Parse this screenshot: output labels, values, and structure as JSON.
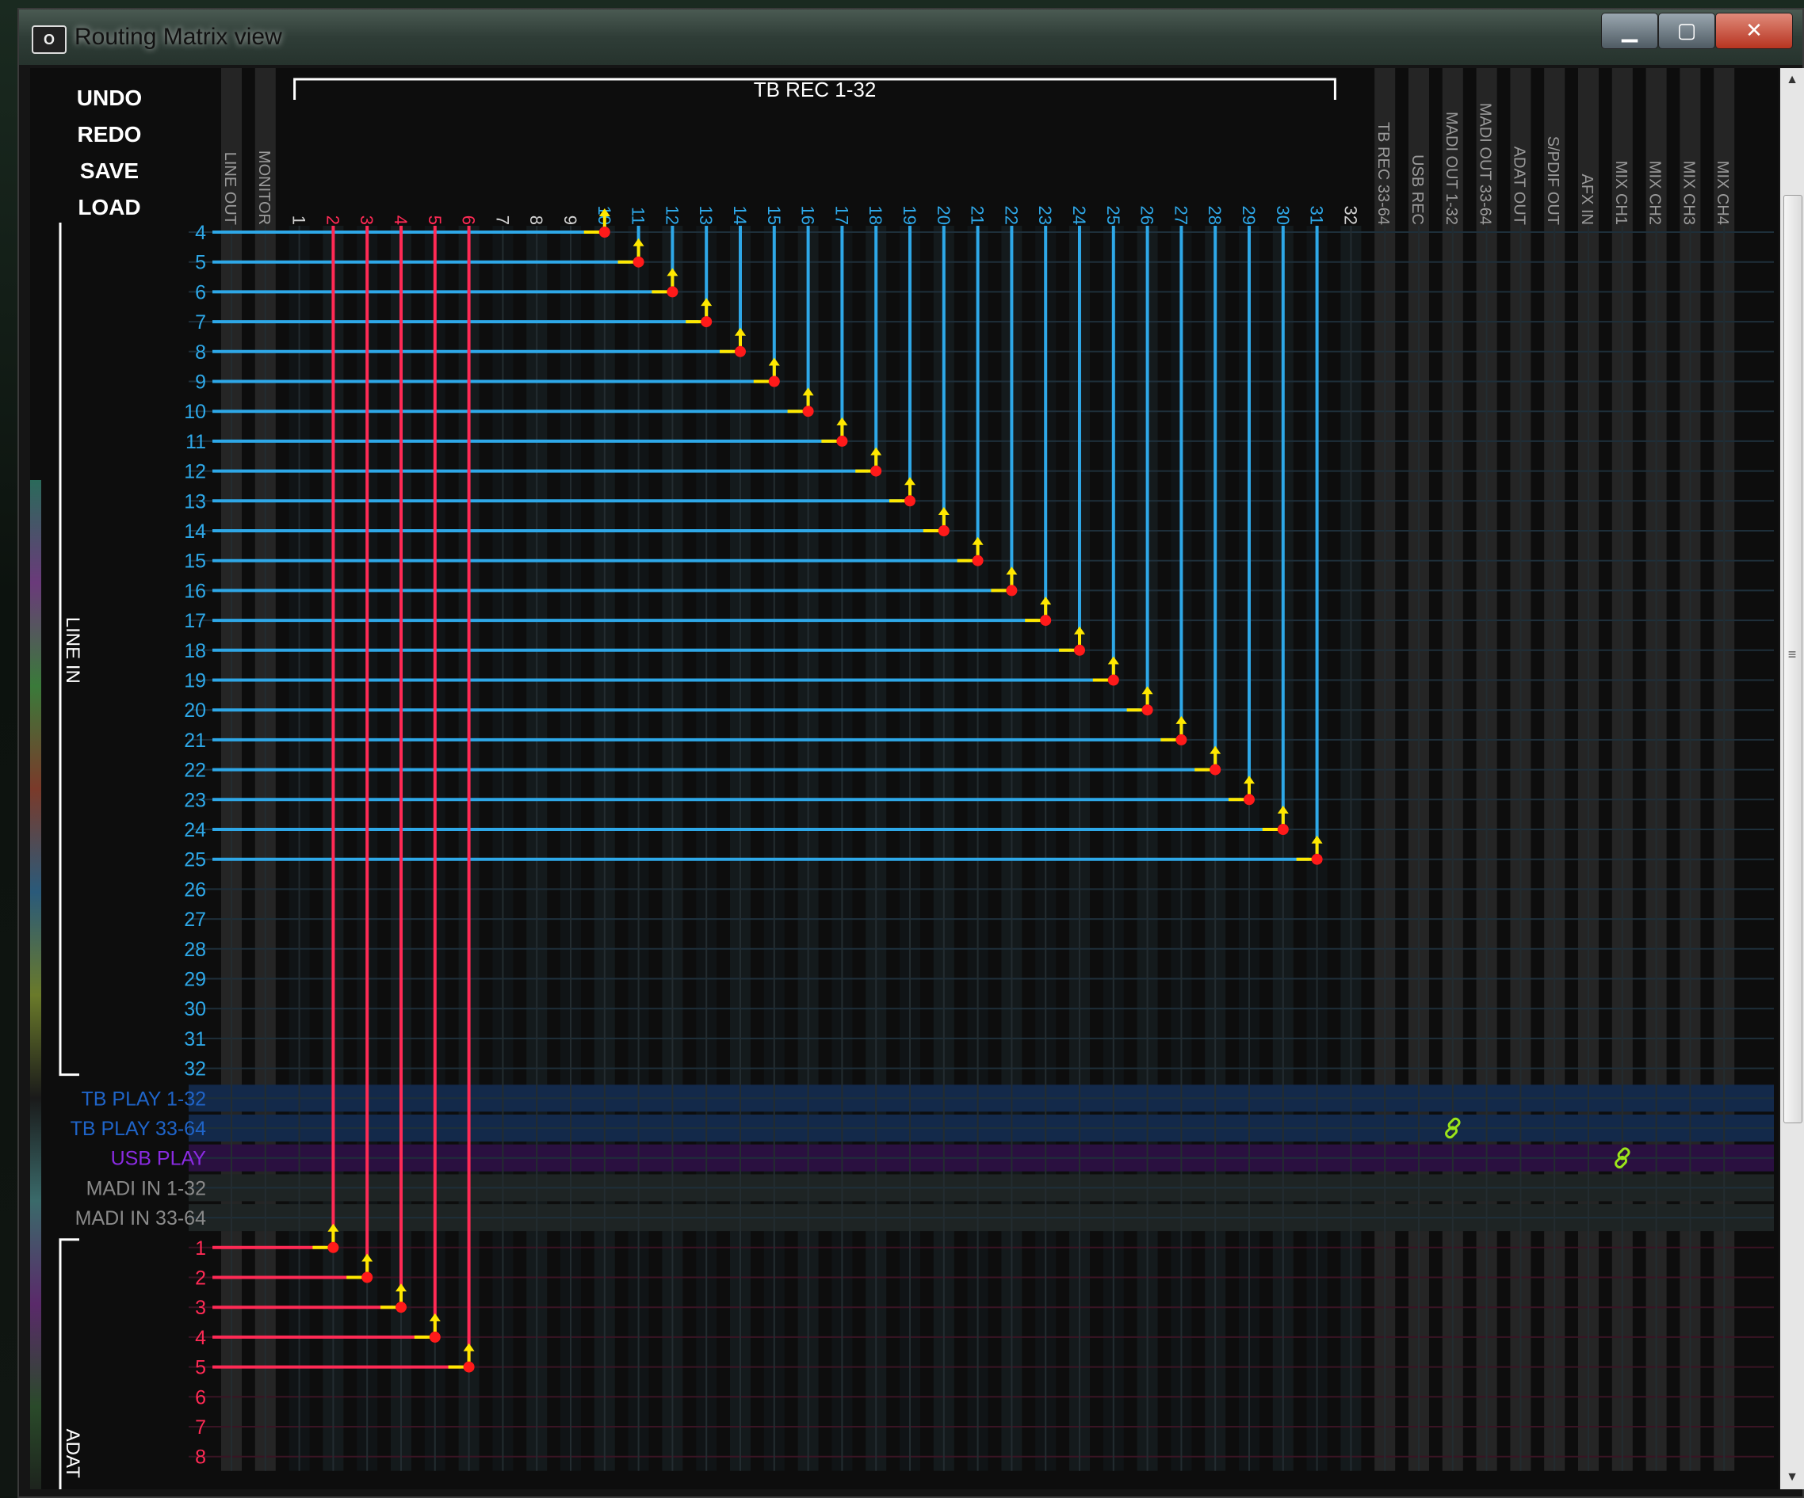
{
  "window": {
    "title": "Routing Matrix view"
  },
  "menu": {
    "undo": "UNDO",
    "redo": "REDO",
    "save": "SAVE",
    "load": "LOAD"
  },
  "header": {
    "group_label": "TB REC 1-32",
    "pre_columns": [
      "LINE OUT",
      "MONITOR"
    ],
    "tb_rec_columns": [
      "1",
      "2",
      "3",
      "4",
      "5",
      "6",
      "7",
      "8",
      "9",
      "10",
      "11",
      "12",
      "13",
      "14",
      "15",
      "16",
      "17",
      "18",
      "19",
      "20",
      "21",
      "22",
      "23",
      "24",
      "25",
      "26",
      "27",
      "28",
      "29",
      "30",
      "31",
      "32"
    ],
    "post_columns": [
      "TB REC 33-64",
      "USB REC",
      "MADI OUT 1-32",
      "MADI OUT 33-64",
      "ADAT OUT",
      "S/PDIF OUT",
      "AFX IN",
      "MIX CH1",
      "MIX CH2",
      "MIX CH3",
      "MIX CH4"
    ]
  },
  "rows": {
    "line_in_label": "LINE IN",
    "line_in": [
      "4",
      "5",
      "6",
      "7",
      "8",
      "9",
      "10",
      "11",
      "12",
      "13",
      "14",
      "15",
      "16",
      "17",
      "18",
      "19",
      "20",
      "21",
      "22",
      "23",
      "24",
      "25",
      "26",
      "27",
      "28",
      "29",
      "30",
      "31",
      "32"
    ],
    "groups": [
      {
        "label": "TB PLAY 1-32",
        "color": "#1f64c8"
      },
      {
        "label": "TB PLAY 33-64",
        "color": "#1f64c8"
      },
      {
        "label": "USB PLAY",
        "color": "#8a2be2"
      },
      {
        "label": "MADI IN 1-32",
        "color": "#8a8a8a"
      },
      {
        "label": "MADI IN 33-64",
        "color": "#8a8a8a"
      }
    ],
    "adat_label": "ADAT",
    "adat": [
      "1",
      "2",
      "3",
      "4",
      "5",
      "6",
      "7",
      "8"
    ]
  },
  "routes": {
    "line_in_to_tb_rec": [
      {
        "in": "4",
        "out": "10"
      },
      {
        "in": "5",
        "out": "11"
      },
      {
        "in": "6",
        "out": "12"
      },
      {
        "in": "7",
        "out": "13"
      },
      {
        "in": "8",
        "out": "14"
      },
      {
        "in": "9",
        "out": "15"
      },
      {
        "in": "10",
        "out": "16"
      },
      {
        "in": "11",
        "out": "17"
      },
      {
        "in": "12",
        "out": "18"
      },
      {
        "in": "13",
        "out": "19"
      },
      {
        "in": "14",
        "out": "20"
      },
      {
        "in": "15",
        "out": "21"
      },
      {
        "in": "16",
        "out": "22"
      },
      {
        "in": "17",
        "out": "23"
      },
      {
        "in": "18",
        "out": "24"
      },
      {
        "in": "19",
        "out": "25"
      },
      {
        "in": "20",
        "out": "26"
      },
      {
        "in": "21",
        "out": "27"
      },
      {
        "in": "22",
        "out": "28"
      },
      {
        "in": "23",
        "out": "29"
      },
      {
        "in": "24",
        "out": "30"
      },
      {
        "in": "25",
        "out": "31"
      }
    ],
    "adat_to_tb_rec": [
      {
        "in": "1",
        "out": "2"
      },
      {
        "in": "2",
        "out": "3"
      },
      {
        "in": "3",
        "out": "4"
      },
      {
        "in": "4",
        "out": "5"
      },
      {
        "in": "5",
        "out": "6"
      }
    ],
    "links": [
      {
        "row": "TB PLAY 33-64",
        "col": "MADI OUT 1-32"
      },
      {
        "row": "USB PLAY",
        "col": "MIX CH1"
      }
    ]
  },
  "colors": {
    "line_in": "#2ea8e8",
    "adat": "#ff2a55",
    "node": "#ff1a1a",
    "arrow": "#ffe800",
    "link": "#9be51a",
    "grid": "#1e2f3a"
  },
  "icons": {
    "link": "link-icon",
    "node": "route-node-icon",
    "app": "app-icon"
  }
}
